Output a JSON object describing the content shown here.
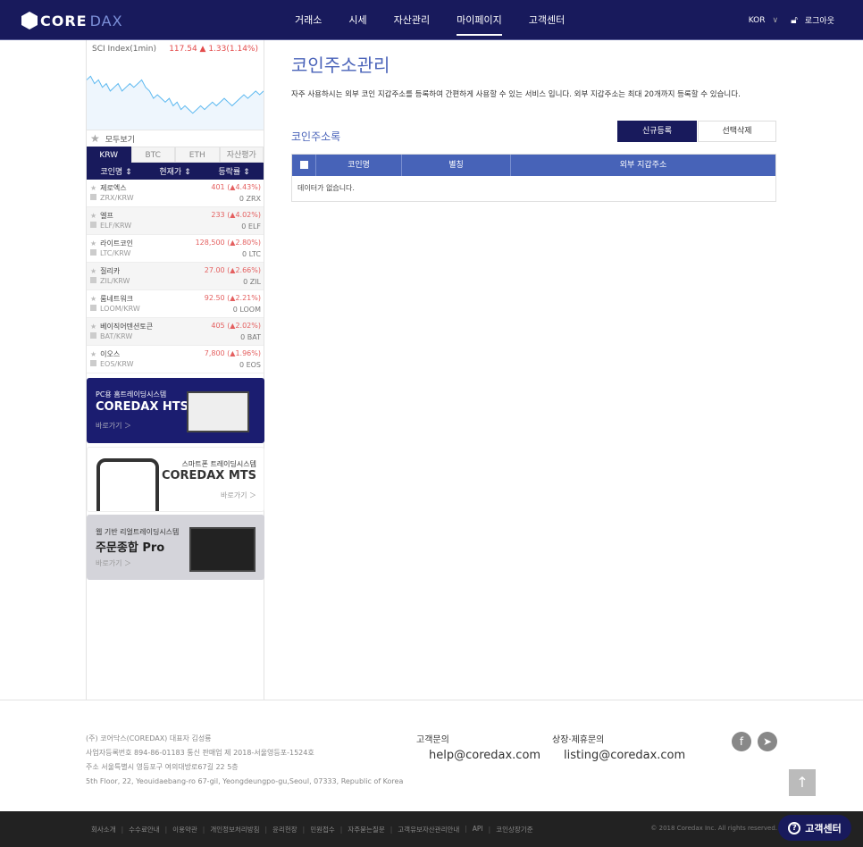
{
  "header": {
    "logo": "COREDAX",
    "nav": [
      "거래소",
      "시세",
      "자산관리",
      "마이페이지",
      "고객센터"
    ],
    "active": "마이페이지",
    "lang": "KOR",
    "logout": "로그아웃"
  },
  "sidebar": {
    "sci": {
      "title": "SCI Index(1min)",
      "value": "117.54 ▲ 1.33(1.14%)",
      "series": [
        120,
        121,
        119,
        120,
        118,
        119,
        117,
        118,
        119,
        117,
        118,
        119,
        118,
        119,
        120,
        118,
        117,
        115,
        116,
        115,
        114,
        115,
        113,
        114,
        112,
        113,
        112,
        111,
        112,
        113,
        112,
        113,
        114,
        113,
        114,
        115,
        114,
        113,
        114,
        115,
        116,
        115,
        116,
        117,
        116,
        117
      ]
    },
    "all_view": "모두보기",
    "tabs": [
      "KRW",
      "BTC",
      "ETH",
      "자산평가"
    ],
    "columns": [
      "코인명 ⇕",
      "현재가 ⇕",
      "등락률 ⇕"
    ],
    "coins": [
      {
        "name": "제로엑스",
        "pair": "ZRX/KRW",
        "price": "401 (▲4.43%)",
        "hold": "0 ZRX"
      },
      {
        "name": "엘프",
        "pair": "ELF/KRW",
        "price": "233 (▲4.02%)",
        "hold": "0 ELF"
      },
      {
        "name": "라이트코인",
        "pair": "LTC/KRW",
        "price": "128,500 (▲2.80%)",
        "hold": "0 LTC"
      },
      {
        "name": "질리카",
        "pair": "ZIL/KRW",
        "price": "27.00 (▲2.66%)",
        "hold": "0 ZIL"
      },
      {
        "name": "룸네트워크",
        "pair": "LOOM/KRW",
        "price": "92.50 (▲2.21%)",
        "hold": "0 LOOM"
      },
      {
        "name": "베이직어텐션토큰",
        "pair": "BAT/KRW",
        "price": "405 (▲2.02%)",
        "hold": "0 BAT"
      },
      {
        "name": "이오스",
        "pair": "EOS/KRW",
        "price": "7,800 (▲1.96%)",
        "hold": "0 EOS"
      }
    ],
    "banners": [
      {
        "sub": "PC용 홈트레이딩시스템",
        "title": "COREDAX HTS",
        "go": "바로가기 ＞"
      },
      {
        "sub": "스마트폰 트레이딩시스템",
        "title": "COREDAX MTS",
        "go": "바로가기 ＞"
      },
      {
        "sub": "웹 기반 리얼트레이딩시스템",
        "title": "주문종합 Pro",
        "go": "바로가기 ＞"
      }
    ]
  },
  "main": {
    "title": "코인주소관리",
    "desc": "자주 사용하시는 외부 코인 지갑주소를 등록하여 간편하게 사용할 수 있는 서비스 입니다. 외부 지갑주소는 최대 20개까지 등록할 수 있습니다.",
    "subtitle": "코인주소록",
    "new_btn": "신규등록",
    "del_btn": "선택삭제",
    "columns": [
      "코인명",
      "별칭",
      "외부 지갑주소"
    ],
    "empty": "데이터가 없습니다."
  },
  "footer": {
    "info": [
      "(주) 코어닥스(COREDAX)     대표자 김성룡",
      "사업자등록번호 894-86-01183     통신 판매업 제 2018-서울영등포-1524호",
      "주소 서울특별시 영등포구 여의대방로67길 22 5층",
      "5th Floor, 22, Yeouidaebang-ro 67-gil, Yeongdeungpo-gu,Seoul, 07333, Republic of Korea"
    ],
    "cs_label": "고객문의",
    "cs_mail": "help@coredax.com",
    "listing_label": "상장·제휴문의",
    "listing_mail": "listing@coredax.com",
    "links": [
      "회사소개",
      "수수료안내",
      "이용약관",
      "개인정보처리방침",
      "윤리헌장",
      "민원접수",
      "자주묻는질문",
      "고객유보자산관리안내",
      "API",
      "코인상장기준"
    ],
    "copyright": "© 2018 Coredax Inc. All rights reserved.",
    "cs_button": "고객센터"
  }
}
